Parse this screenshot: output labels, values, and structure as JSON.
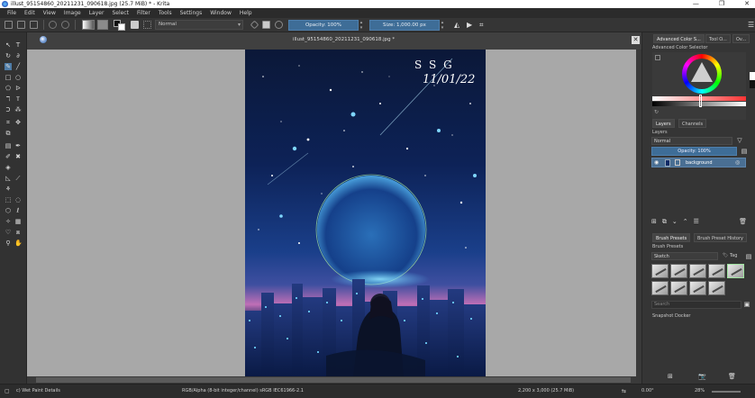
{
  "window": {
    "title": "illust_95154860_20211231_090618.jpg (25.7 MiB)  * - Krita",
    "minimize": "—",
    "maximize": "❐",
    "close": "✕"
  },
  "menu": [
    "File",
    "Edit",
    "View",
    "Image",
    "Layer",
    "Select",
    "Filter",
    "Tools",
    "Settings",
    "Window",
    "Help"
  ],
  "toolbar": {
    "blend_mode": "Normal",
    "opacity_label": "Opacity: 100%",
    "size_label": "Size: 1,000.00 px"
  },
  "document": {
    "tab_name": "illust_95154860_20211231_090618.jpg *"
  },
  "artwork": {
    "signature_line1": "S S G",
    "signature_line2": "11/01/22"
  },
  "dock": {
    "top_tabs": [
      "Advanced Color S...",
      "Tool O...",
      "Ov..."
    ],
    "color_selector_title": "Advanced Color Selector",
    "layers_tabs": [
      "Layers",
      "Channels"
    ],
    "layers_title": "Layers",
    "layer_blend": "Normal",
    "layer_opacity": "Opacity: 100%",
    "layer_name": "background",
    "brush_tabs": [
      "Brush Presets",
      "Brush Preset History"
    ],
    "brush_presets_title": "Brush Presets",
    "brush_tag": "Sketch",
    "tag_label": "Tag",
    "search_placeholder": "Search",
    "snapshot_title": "Snapshot Docker"
  },
  "status": {
    "brush": "c) Wet Paint Details",
    "color_space": "RGB/Alpha (8-bit integer/channel)  sRGB IEC61966-2.1",
    "dimensions": "2,200 x 3,000 (25.7 MiB)",
    "rotation": "0.00°",
    "zoom": "28%"
  },
  "colors": {
    "accent": "#4f7da8",
    "sky_top": "#0b1838",
    "glow": "#5fc8ff"
  }
}
